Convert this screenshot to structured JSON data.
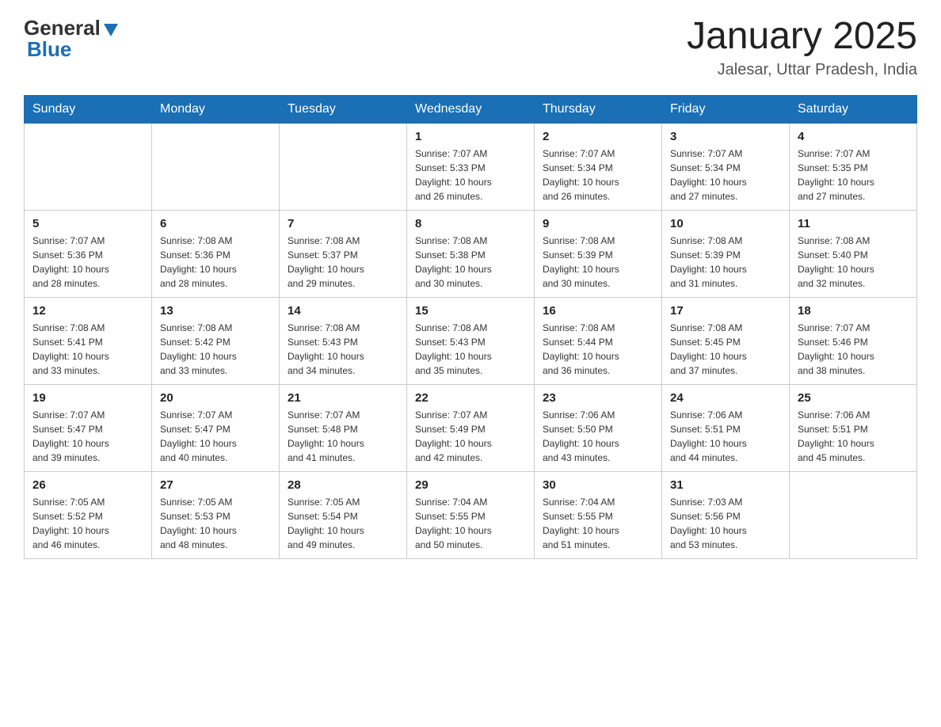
{
  "header": {
    "logo_general": "General",
    "logo_blue": "Blue",
    "title": "January 2025",
    "subtitle": "Jalesar, Uttar Pradesh, India"
  },
  "weekdays": [
    "Sunday",
    "Monday",
    "Tuesday",
    "Wednesday",
    "Thursday",
    "Friday",
    "Saturday"
  ],
  "weeks": [
    [
      {
        "day": "",
        "info": ""
      },
      {
        "day": "",
        "info": ""
      },
      {
        "day": "",
        "info": ""
      },
      {
        "day": "1",
        "info": "Sunrise: 7:07 AM\nSunset: 5:33 PM\nDaylight: 10 hours\nand 26 minutes."
      },
      {
        "day": "2",
        "info": "Sunrise: 7:07 AM\nSunset: 5:34 PM\nDaylight: 10 hours\nand 26 minutes."
      },
      {
        "day": "3",
        "info": "Sunrise: 7:07 AM\nSunset: 5:34 PM\nDaylight: 10 hours\nand 27 minutes."
      },
      {
        "day": "4",
        "info": "Sunrise: 7:07 AM\nSunset: 5:35 PM\nDaylight: 10 hours\nand 27 minutes."
      }
    ],
    [
      {
        "day": "5",
        "info": "Sunrise: 7:07 AM\nSunset: 5:36 PM\nDaylight: 10 hours\nand 28 minutes."
      },
      {
        "day": "6",
        "info": "Sunrise: 7:08 AM\nSunset: 5:36 PM\nDaylight: 10 hours\nand 28 minutes."
      },
      {
        "day": "7",
        "info": "Sunrise: 7:08 AM\nSunset: 5:37 PM\nDaylight: 10 hours\nand 29 minutes."
      },
      {
        "day": "8",
        "info": "Sunrise: 7:08 AM\nSunset: 5:38 PM\nDaylight: 10 hours\nand 30 minutes."
      },
      {
        "day": "9",
        "info": "Sunrise: 7:08 AM\nSunset: 5:39 PM\nDaylight: 10 hours\nand 30 minutes."
      },
      {
        "day": "10",
        "info": "Sunrise: 7:08 AM\nSunset: 5:39 PM\nDaylight: 10 hours\nand 31 minutes."
      },
      {
        "day": "11",
        "info": "Sunrise: 7:08 AM\nSunset: 5:40 PM\nDaylight: 10 hours\nand 32 minutes."
      }
    ],
    [
      {
        "day": "12",
        "info": "Sunrise: 7:08 AM\nSunset: 5:41 PM\nDaylight: 10 hours\nand 33 minutes."
      },
      {
        "day": "13",
        "info": "Sunrise: 7:08 AM\nSunset: 5:42 PM\nDaylight: 10 hours\nand 33 minutes."
      },
      {
        "day": "14",
        "info": "Sunrise: 7:08 AM\nSunset: 5:43 PM\nDaylight: 10 hours\nand 34 minutes."
      },
      {
        "day": "15",
        "info": "Sunrise: 7:08 AM\nSunset: 5:43 PM\nDaylight: 10 hours\nand 35 minutes."
      },
      {
        "day": "16",
        "info": "Sunrise: 7:08 AM\nSunset: 5:44 PM\nDaylight: 10 hours\nand 36 minutes."
      },
      {
        "day": "17",
        "info": "Sunrise: 7:08 AM\nSunset: 5:45 PM\nDaylight: 10 hours\nand 37 minutes."
      },
      {
        "day": "18",
        "info": "Sunrise: 7:07 AM\nSunset: 5:46 PM\nDaylight: 10 hours\nand 38 minutes."
      }
    ],
    [
      {
        "day": "19",
        "info": "Sunrise: 7:07 AM\nSunset: 5:47 PM\nDaylight: 10 hours\nand 39 minutes."
      },
      {
        "day": "20",
        "info": "Sunrise: 7:07 AM\nSunset: 5:47 PM\nDaylight: 10 hours\nand 40 minutes."
      },
      {
        "day": "21",
        "info": "Sunrise: 7:07 AM\nSunset: 5:48 PM\nDaylight: 10 hours\nand 41 minutes."
      },
      {
        "day": "22",
        "info": "Sunrise: 7:07 AM\nSunset: 5:49 PM\nDaylight: 10 hours\nand 42 minutes."
      },
      {
        "day": "23",
        "info": "Sunrise: 7:06 AM\nSunset: 5:50 PM\nDaylight: 10 hours\nand 43 minutes."
      },
      {
        "day": "24",
        "info": "Sunrise: 7:06 AM\nSunset: 5:51 PM\nDaylight: 10 hours\nand 44 minutes."
      },
      {
        "day": "25",
        "info": "Sunrise: 7:06 AM\nSunset: 5:51 PM\nDaylight: 10 hours\nand 45 minutes."
      }
    ],
    [
      {
        "day": "26",
        "info": "Sunrise: 7:05 AM\nSunset: 5:52 PM\nDaylight: 10 hours\nand 46 minutes."
      },
      {
        "day": "27",
        "info": "Sunrise: 7:05 AM\nSunset: 5:53 PM\nDaylight: 10 hours\nand 48 minutes."
      },
      {
        "day": "28",
        "info": "Sunrise: 7:05 AM\nSunset: 5:54 PM\nDaylight: 10 hours\nand 49 minutes."
      },
      {
        "day": "29",
        "info": "Sunrise: 7:04 AM\nSunset: 5:55 PM\nDaylight: 10 hours\nand 50 minutes."
      },
      {
        "day": "30",
        "info": "Sunrise: 7:04 AM\nSunset: 5:55 PM\nDaylight: 10 hours\nand 51 minutes."
      },
      {
        "day": "31",
        "info": "Sunrise: 7:03 AM\nSunset: 5:56 PM\nDaylight: 10 hours\nand 53 minutes."
      },
      {
        "day": "",
        "info": ""
      }
    ]
  ]
}
